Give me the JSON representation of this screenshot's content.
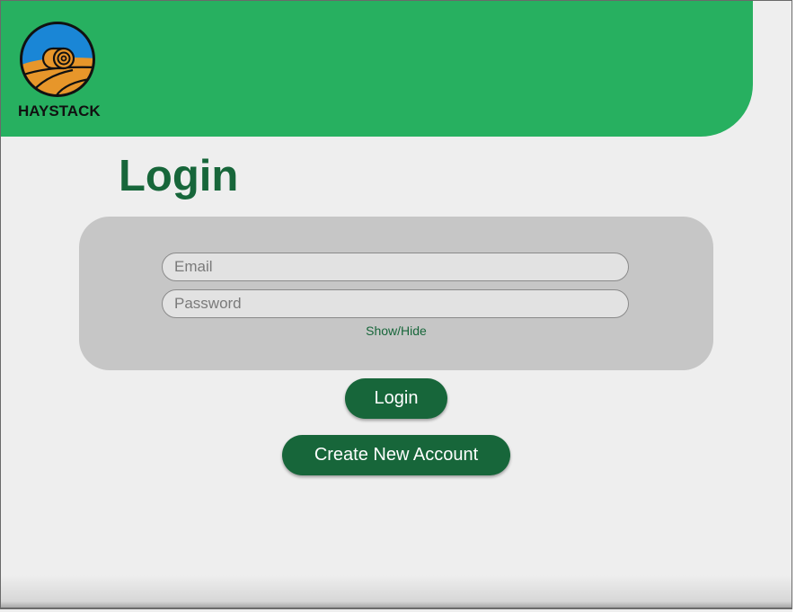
{
  "app": {
    "brand_name": "HAYSTACK",
    "logo_icon": "haystack-logo-icon"
  },
  "page": {
    "title": "Login"
  },
  "form": {
    "email_placeholder": "Email",
    "email_value": "",
    "password_placeholder": "Password",
    "password_value": "",
    "show_hide_label": "Show/Hide"
  },
  "actions": {
    "login_label": "Login",
    "create_account_label": "Create New Account"
  },
  "colors": {
    "header_green": "#27b060",
    "dark_green": "#17663a",
    "panel_gray": "#c6c6c6",
    "background": "#eeeeee",
    "logo_sky": "#1a86d6",
    "logo_field": "#e7962a"
  }
}
